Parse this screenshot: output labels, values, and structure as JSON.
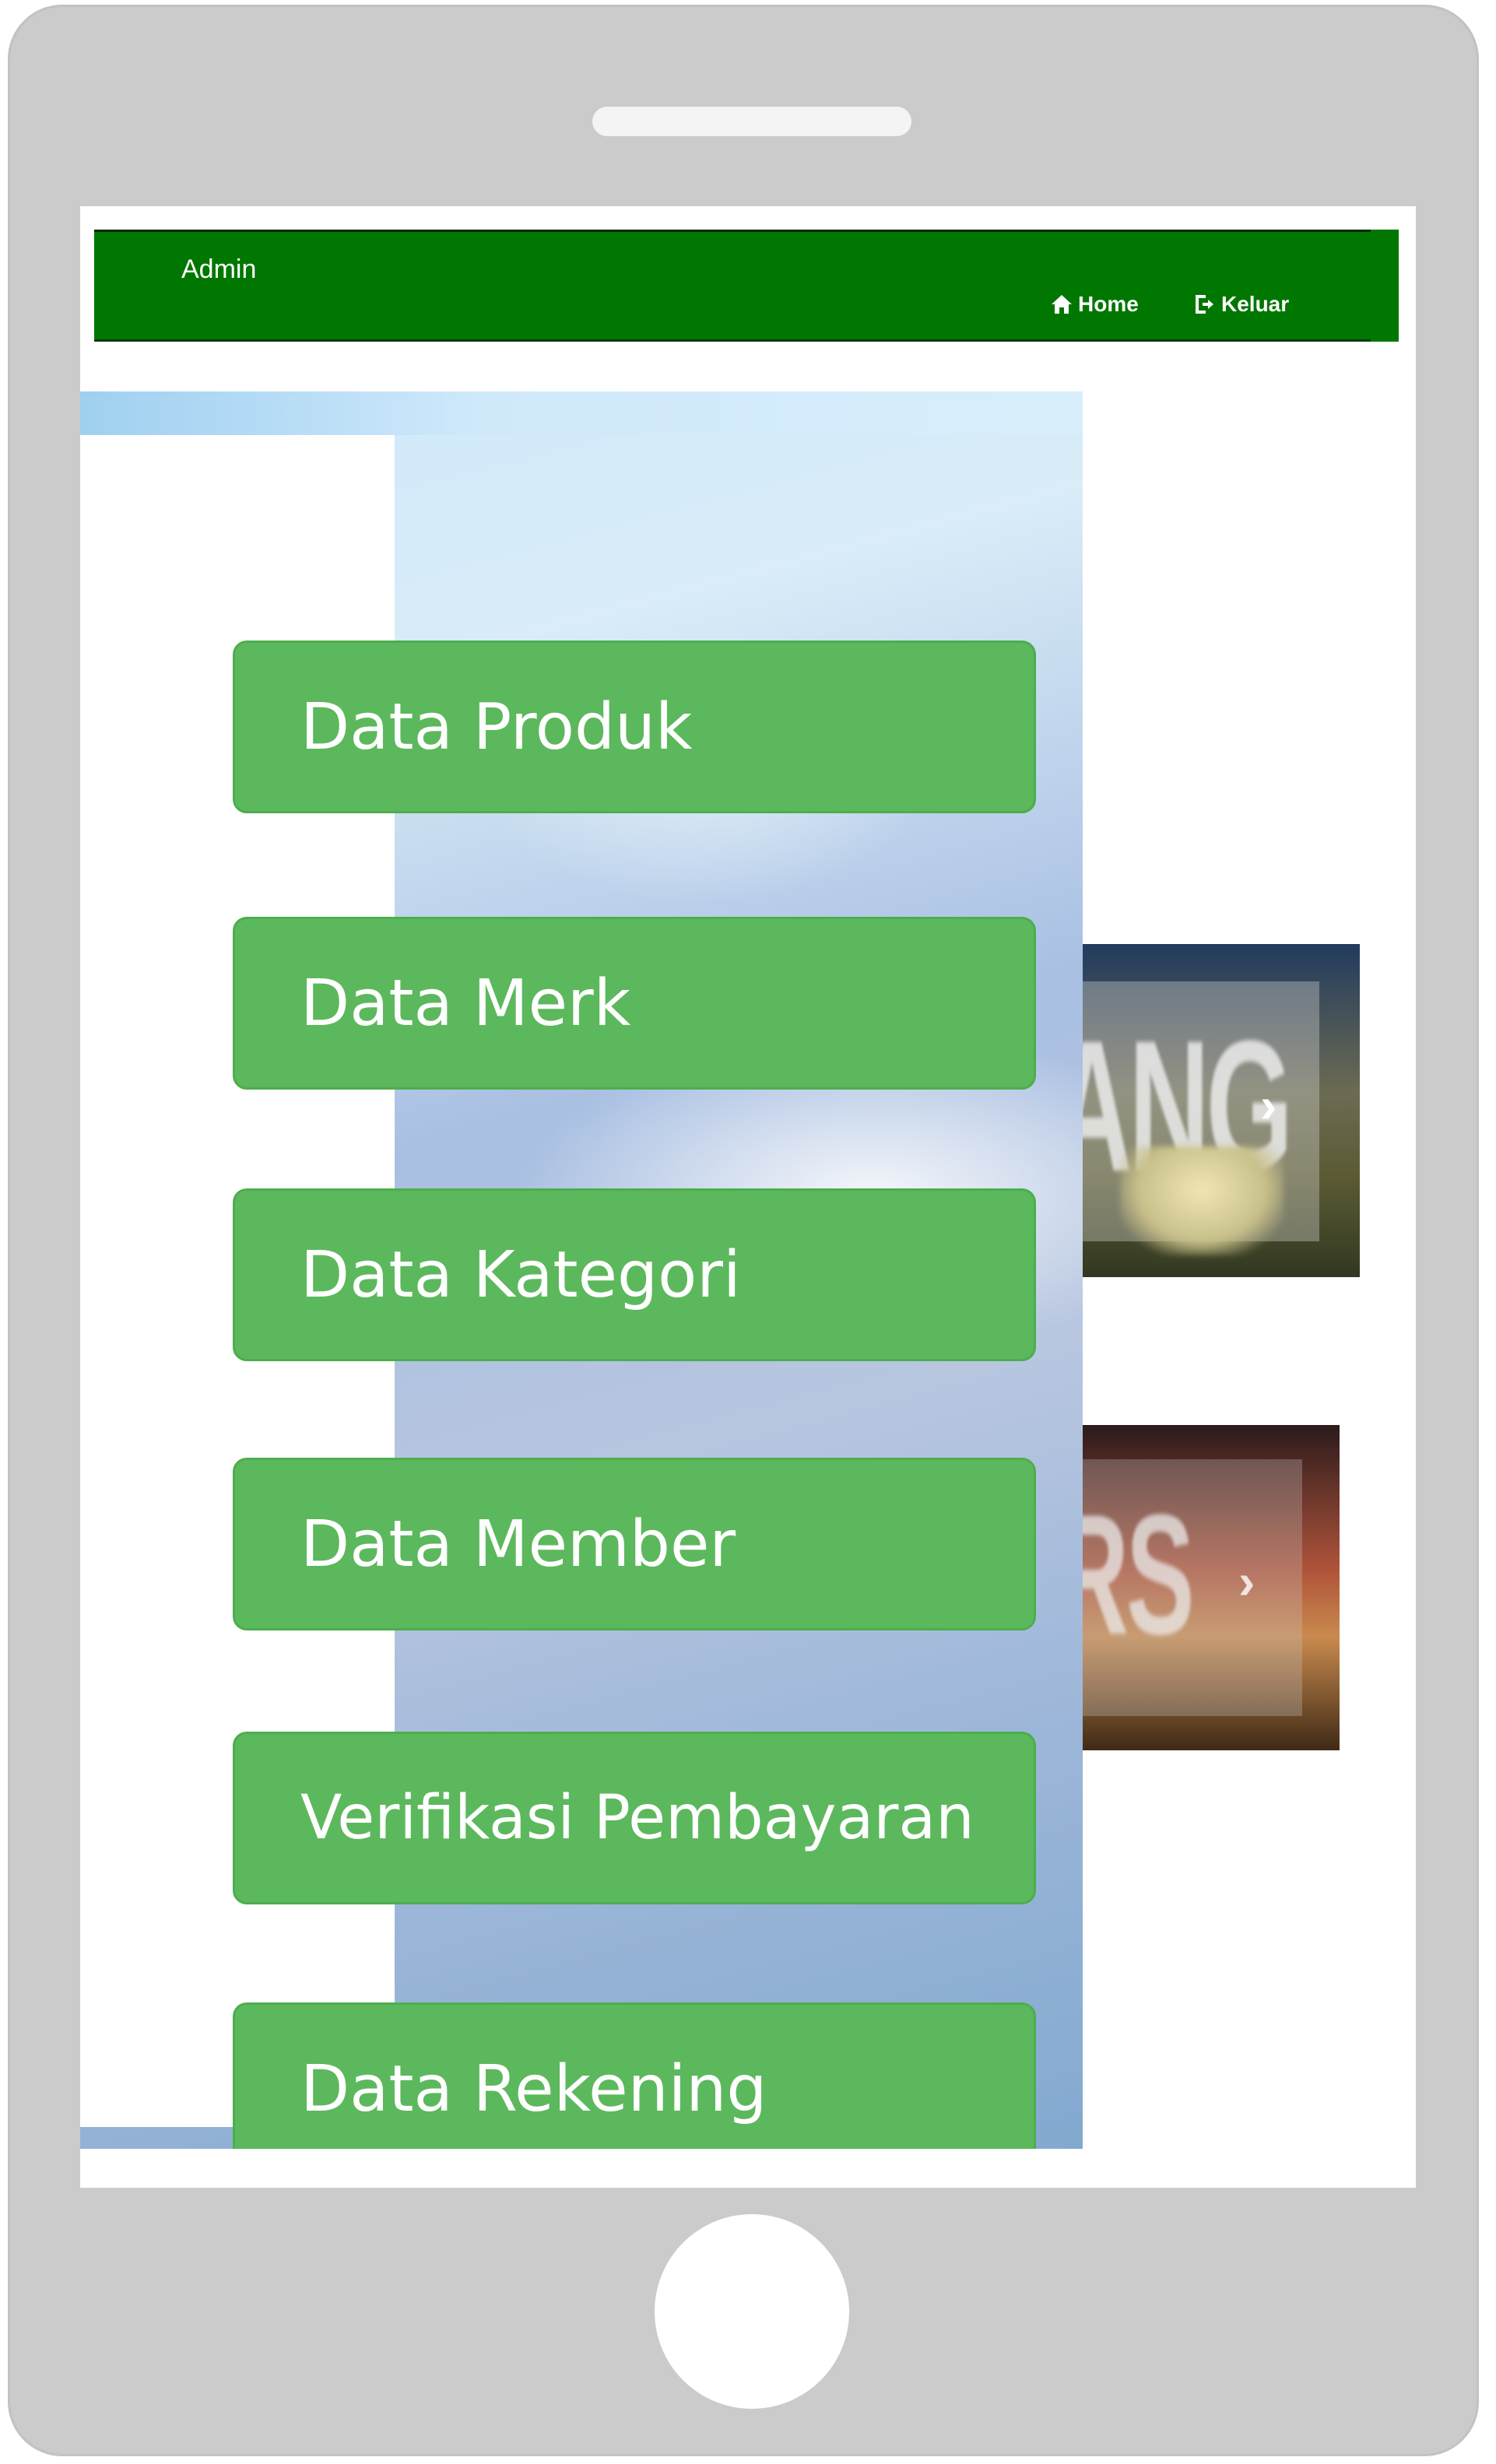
{
  "navbar": {
    "brand": "Admin",
    "home_label": "Home",
    "logout_label": "Keluar",
    "home_icon": "home-icon",
    "logout_icon": "logout-icon",
    "color": "#007700"
  },
  "slides": [
    {
      "text": "ANG",
      "arrow": "›"
    },
    {
      "text": "RS",
      "arrow": "›"
    }
  ],
  "menu": {
    "items": [
      {
        "label": "Data Produk"
      },
      {
        "label": "Data Merk"
      },
      {
        "label": "Data Kategori"
      },
      {
        "label": "Data Member"
      },
      {
        "label": "Verifikasi Pembayaran"
      },
      {
        "label": "Data Rekening"
      }
    ],
    "button_color": "#5cb85c"
  }
}
